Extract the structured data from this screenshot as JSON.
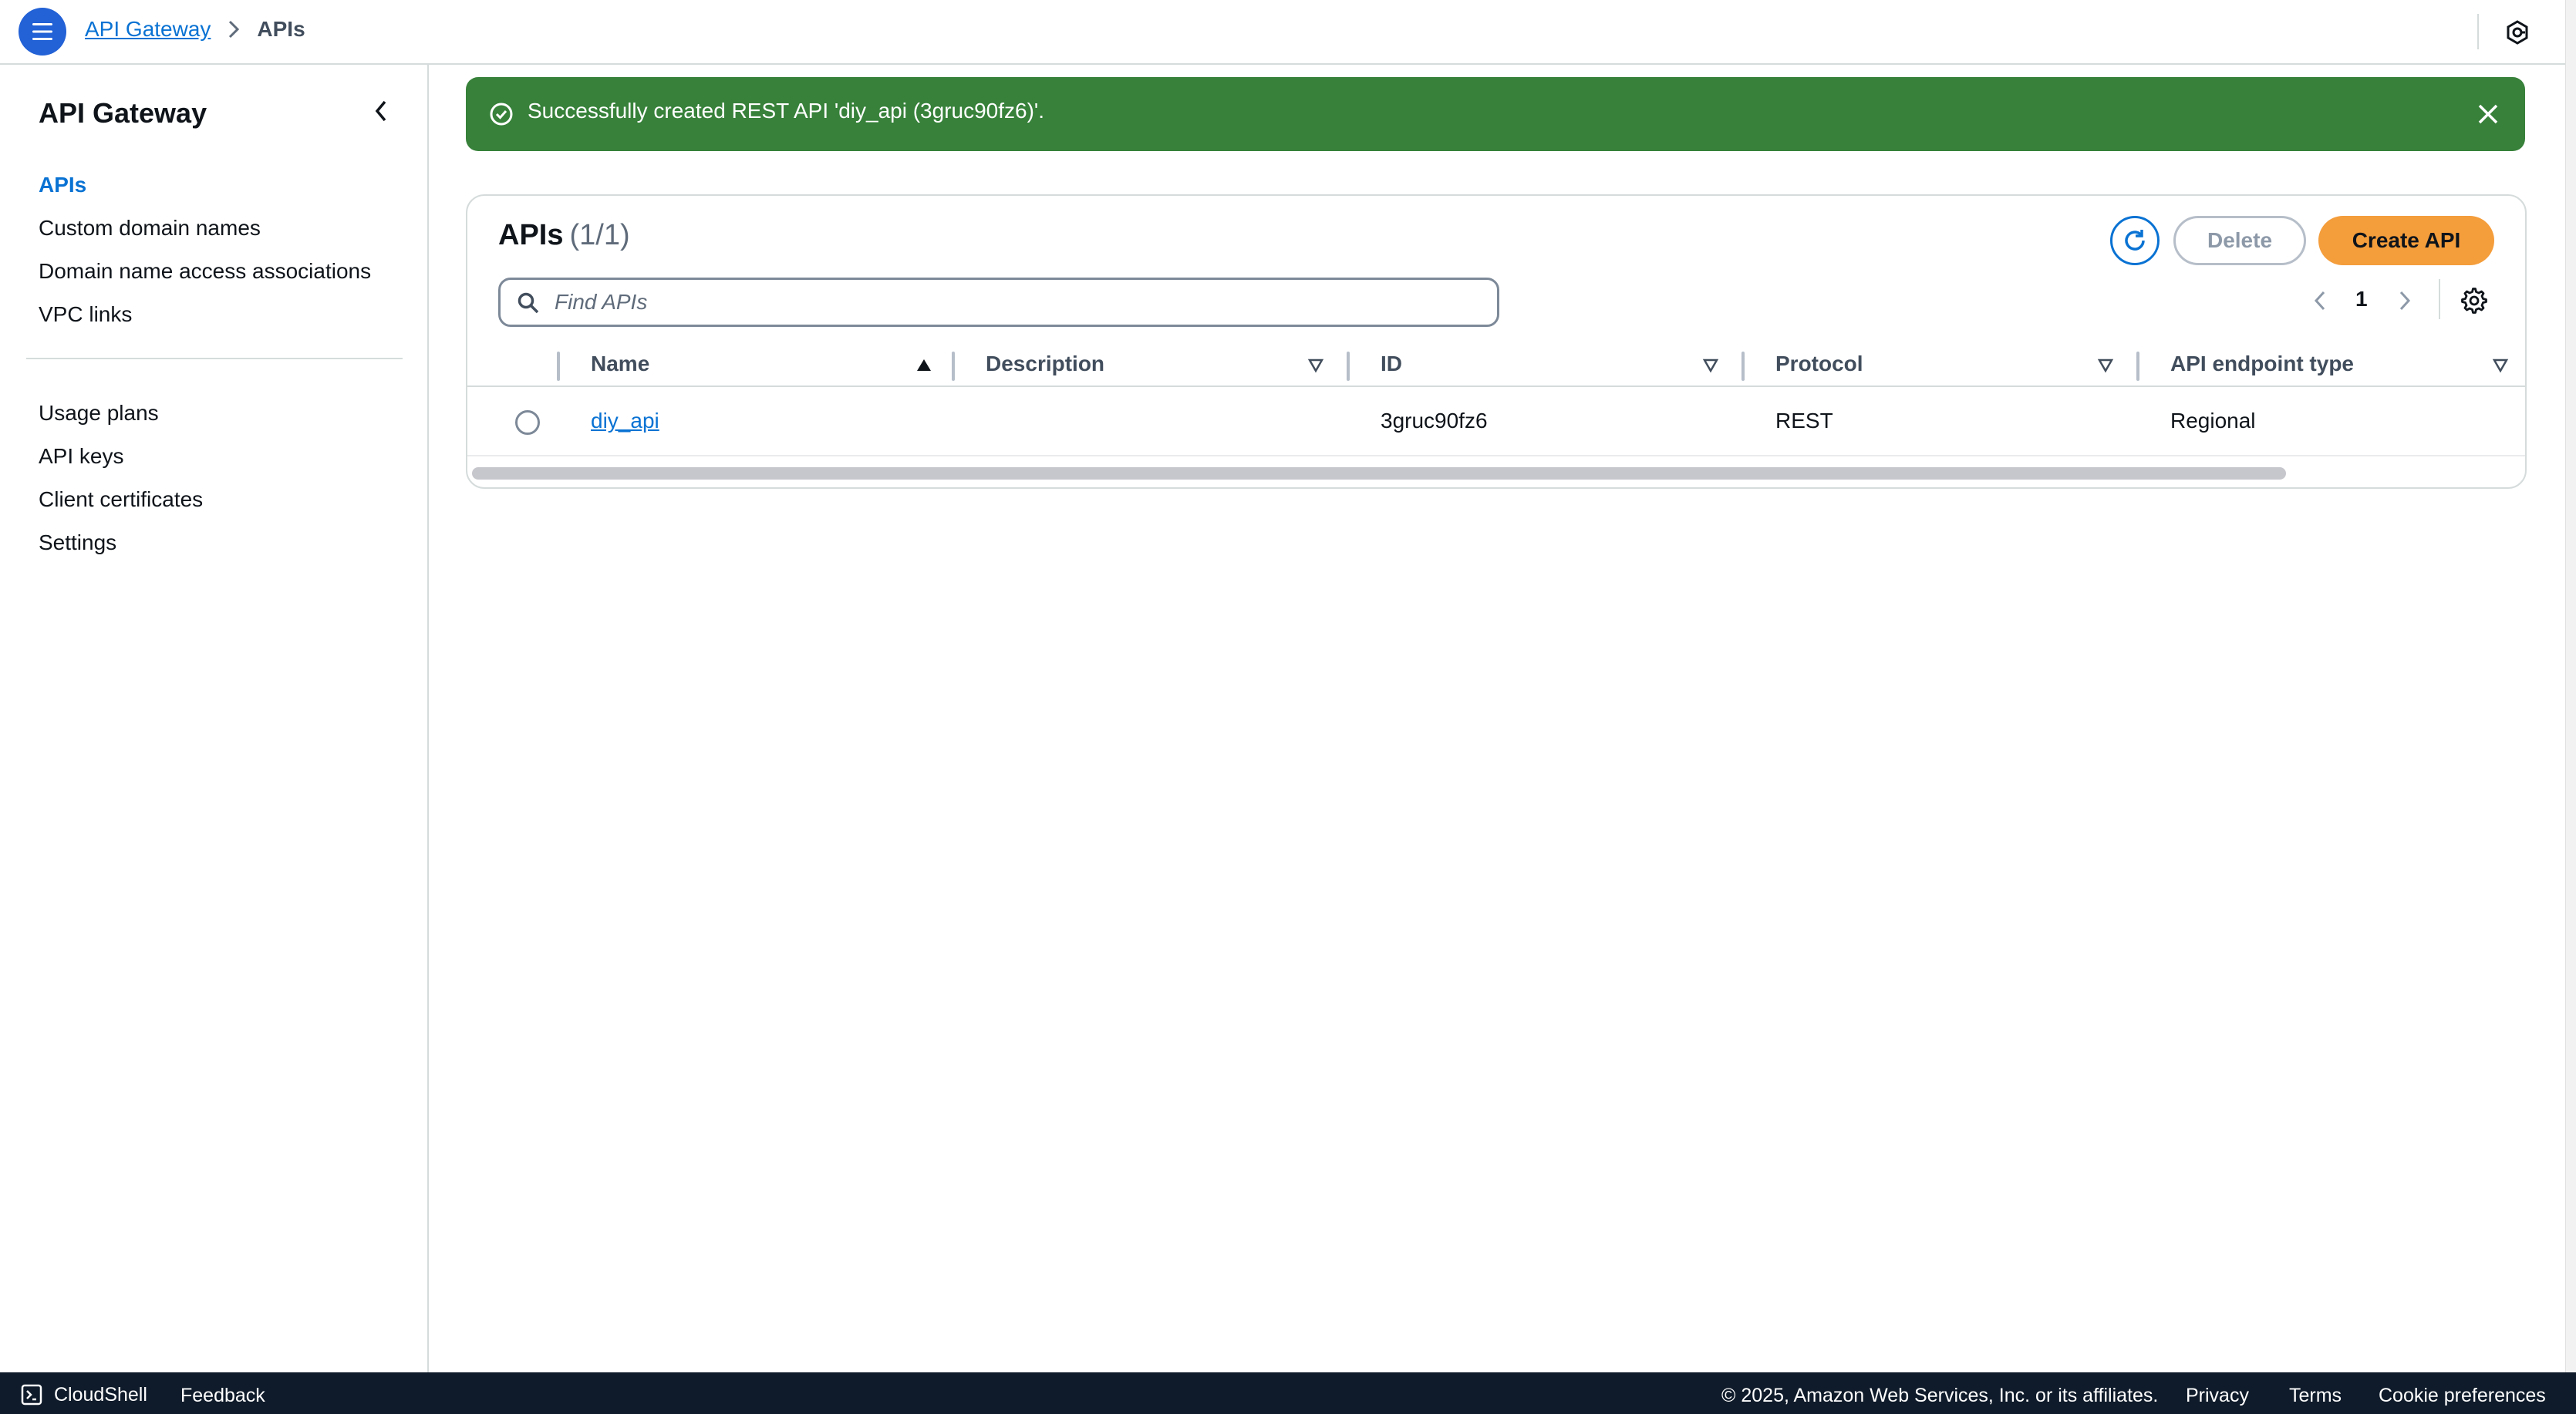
{
  "header": {
    "breadcrumb": [
      {
        "label": "API Gateway"
      },
      {
        "label": "APIs"
      }
    ]
  },
  "sidebar": {
    "title": "API Gateway",
    "items": [
      {
        "label": "APIs",
        "active": true
      },
      {
        "label": "Custom domain names"
      },
      {
        "label": "Domain name access associations"
      },
      {
        "label": "VPC links"
      }
    ],
    "items2": [
      {
        "label": "Usage plans"
      },
      {
        "label": "API keys"
      },
      {
        "label": "Client certificates"
      },
      {
        "label": "Settings"
      }
    ]
  },
  "flash": {
    "message": "Successfully created REST API 'diy_api (3gruc90fz6)'.",
    "color": "#37813a"
  },
  "apis": {
    "title": "APIs",
    "count": "(1/1)",
    "delete_label": "Delete",
    "create_label": "Create API",
    "search_placeholder": "Find APIs",
    "search_value": "",
    "page": "1",
    "columns": [
      "Name",
      "Description",
      "ID",
      "Protocol",
      "API endpoint type"
    ],
    "rows": [
      {
        "name": "diy_api",
        "description": "",
        "id": "3gruc90fz6",
        "protocol": "REST",
        "endpoint_type": "Regional"
      }
    ],
    "sort_column": "Name",
    "sort_direction": "ascending"
  },
  "footer": {
    "cloudshell": "CloudShell",
    "feedback": "Feedback",
    "copyright": "© 2025, Amazon Web Services, Inc. or its affiliates.",
    "privacy": "Privacy",
    "terms": "Terms",
    "cookie": "Cookie preferences"
  },
  "colors": {
    "accent": "#0972d3",
    "primary_button": "#f49d3b",
    "footer_bg": "#0f1b2a",
    "menu_button": "#2261d6"
  },
  "icons": [
    "menu-icon",
    "chevron-right-icon",
    "shield-hex-icon",
    "chevron-left-icon",
    "check-circle-icon",
    "close-icon",
    "refresh-icon",
    "search-icon",
    "settings-gear-icon",
    "sort-ascending-icon",
    "sort-icon",
    "terminal-icon"
  ]
}
